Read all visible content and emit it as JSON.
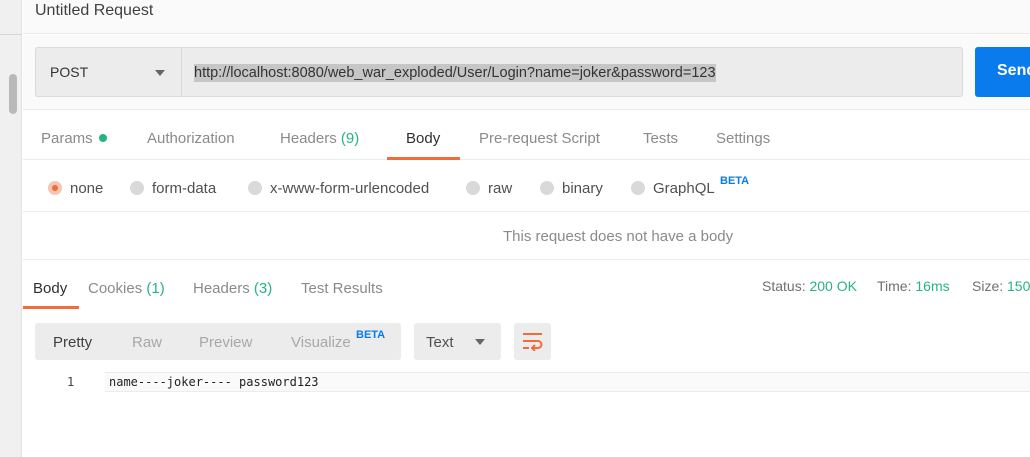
{
  "window": {
    "title": "Untitled Request"
  },
  "request": {
    "method": "POST",
    "url": "http://localhost:8080/web_war_exploded/User/Login?name=joker&password=123",
    "send_label": "Send"
  },
  "request_tabs": [
    {
      "label": "Params",
      "has_dot": true
    },
    {
      "label": "Authorization"
    },
    {
      "label": "Headers",
      "count": "(9)"
    },
    {
      "label": "Body",
      "active": true
    },
    {
      "label": "Pre-request Script"
    },
    {
      "label": "Tests"
    },
    {
      "label": "Settings"
    }
  ],
  "body_types": [
    {
      "label": "none",
      "checked": true
    },
    {
      "label": "form-data"
    },
    {
      "label": "x-www-form-urlencoded"
    },
    {
      "label": "raw"
    },
    {
      "label": "binary"
    },
    {
      "label": "GraphQL",
      "badge": "BETA"
    }
  ],
  "no_body_message": "This request does not have a body",
  "response_tabs": [
    {
      "label": "Body",
      "active": true
    },
    {
      "label": "Cookies",
      "count": "(1)"
    },
    {
      "label": "Headers",
      "count": "(3)"
    },
    {
      "label": "Test Results"
    }
  ],
  "response_meta": {
    "status_label": "Status:",
    "status_value": "200 OK",
    "time_label": "Time:",
    "time_value": "16ms",
    "size_label": "Size:",
    "size_value": "150"
  },
  "view_modes": [
    {
      "label": "Pretty",
      "active": true
    },
    {
      "label": "Raw"
    },
    {
      "label": "Preview"
    },
    {
      "label": "Visualize",
      "badge": "BETA"
    }
  ],
  "format": {
    "selected": "Text"
  },
  "response_body": {
    "lines": [
      {
        "number": "1",
        "text": "name----joker---- password123"
      }
    ]
  },
  "colors": {
    "accent": "#f26b3a",
    "primary": "#097bed",
    "success": "#26b47f"
  },
  "icons": [
    "caret-down-icon",
    "wrap-lines-icon",
    "dot-icon"
  ]
}
